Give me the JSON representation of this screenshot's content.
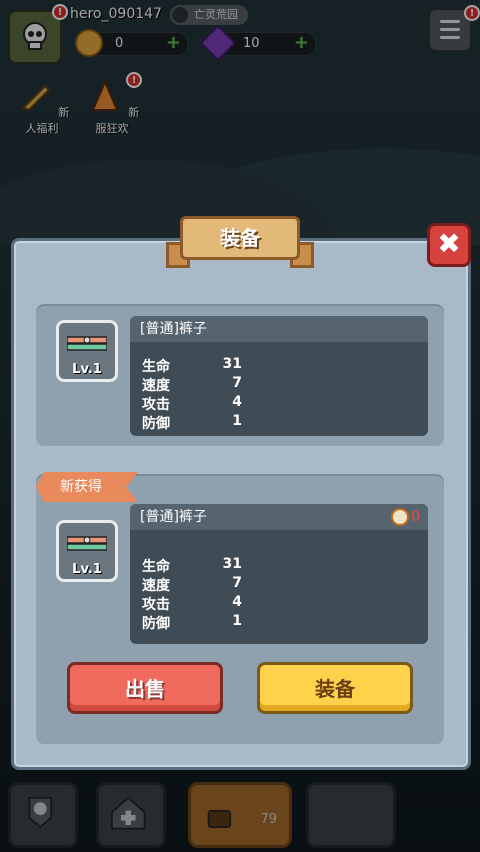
{
  "player": {
    "username": "hero_090147",
    "guild_tag": "亡灵荒园",
    "coins": "0",
    "gems": "10"
  },
  "events": [
    {
      "label": "新人福利"
    },
    {
      "label": "新服狂欢"
    }
  ],
  "modal": {
    "title": "装备",
    "close_label": "✖",
    "current": {
      "item_name": "[普通]裤子",
      "level": "Lv.1",
      "stats": [
        {
          "label": "生命",
          "value": "31"
        },
        {
          "label": "速度",
          "value": "7"
        },
        {
          "label": "攻击",
          "value": "4"
        },
        {
          "label": "防御",
          "value": "1"
        }
      ]
    },
    "new_tag": "新获得",
    "new_item": {
      "item_name": "[普通]裤子",
      "level": "Lv.1",
      "power": "0",
      "stats": [
        {
          "label": "生命",
          "value": "31"
        },
        {
          "label": "速度",
          "value": "7"
        },
        {
          "label": "攻击",
          "value": "4"
        },
        {
          "label": "防御",
          "value": "1"
        }
      ]
    },
    "sell_label": "出售",
    "equip_label": "装备"
  },
  "bottom_nav": {
    "center_count": "79"
  },
  "colors": {
    "panel": "#a9b9c7",
    "sell": "#f06a5e",
    "equip": "#ffd24b",
    "ribbon": "#e3b97a"
  }
}
